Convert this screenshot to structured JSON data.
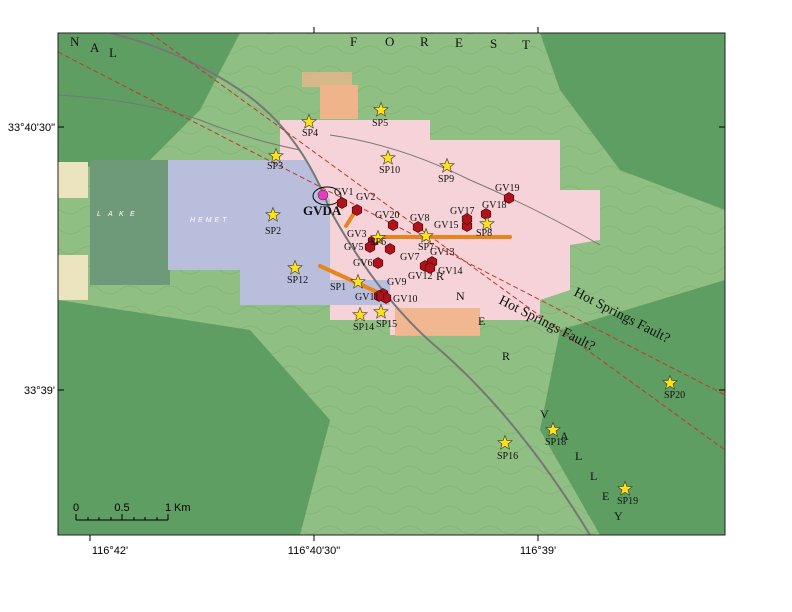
{
  "map": {
    "background_color": "#8fbf82",
    "forest_dark_color": "#5f9e62",
    "pink_zone_color": "#f6d3d8",
    "blue_zone_color": "#b9bedc",
    "orange_zone_color": "#f0b48a",
    "fault_color": "#c0392b",
    "road_color": "#777777",
    "star_color": "#ffe21a",
    "gv_color": "#b0121b",
    "profile_color": "#e8841b",
    "gvda_marker_color": "#e040c0"
  },
  "top_labels": {
    "left_letters": [
      "N",
      "A",
      "L"
    ],
    "forest_letters": [
      "F",
      "O",
      "R",
      "E",
      "S",
      "T"
    ],
    "valley_top_letters": [
      "R",
      "N",
      "E",
      "R"
    ],
    "valley_bottom_letters": [
      "V",
      "A",
      "L",
      "L",
      "E",
      "Y"
    ],
    "lake_letters": [
      "L",
      "A",
      "K",
      "E"
    ],
    "lake_name": "HEMET"
  },
  "axis": {
    "lat_labels": [
      "33°40'30\"",
      "33°39'"
    ],
    "lon_labels": [
      "116°42'",
      "116°40'30\"",
      "116°39'"
    ]
  },
  "fault_labels": [
    "Hot Springs Fault?",
    "Hot Springs Fault?"
  ],
  "gvda_label": "GVDA",
  "scale_bar": {
    "labels": [
      "0",
      "0.5",
      "1"
    ],
    "unit": "Km"
  },
  "sp_stations": [
    {
      "id": "SP1"
    },
    {
      "id": "SP2"
    },
    {
      "id": "SP3"
    },
    {
      "id": "SP4"
    },
    {
      "id": "SP5"
    },
    {
      "id": "SP6"
    },
    {
      "id": "SP7"
    },
    {
      "id": "SP8"
    },
    {
      "id": "SP9"
    },
    {
      "id": "SP10"
    },
    {
      "id": "SP12"
    },
    {
      "id": "SP14"
    },
    {
      "id": "SP15"
    },
    {
      "id": "SP16"
    },
    {
      "id": "SP18"
    },
    {
      "id": "SP19"
    },
    {
      "id": "SP20"
    }
  ],
  "gv_wells": [
    {
      "id": "GV1"
    },
    {
      "id": "GV2"
    },
    {
      "id": "GV3"
    },
    {
      "id": "GV5"
    },
    {
      "id": "GV6"
    },
    {
      "id": "GV7"
    },
    {
      "id": "GV8"
    },
    {
      "id": "GV9"
    },
    {
      "id": "GV10"
    },
    {
      "id": "GV11"
    },
    {
      "id": "GV12"
    },
    {
      "id": "GV13"
    },
    {
      "id": "GV14"
    },
    {
      "id": "GV15"
    },
    {
      "id": "GV17"
    },
    {
      "id": "GV18"
    },
    {
      "id": "GV19"
    },
    {
      "id": "GV20"
    }
  ]
}
